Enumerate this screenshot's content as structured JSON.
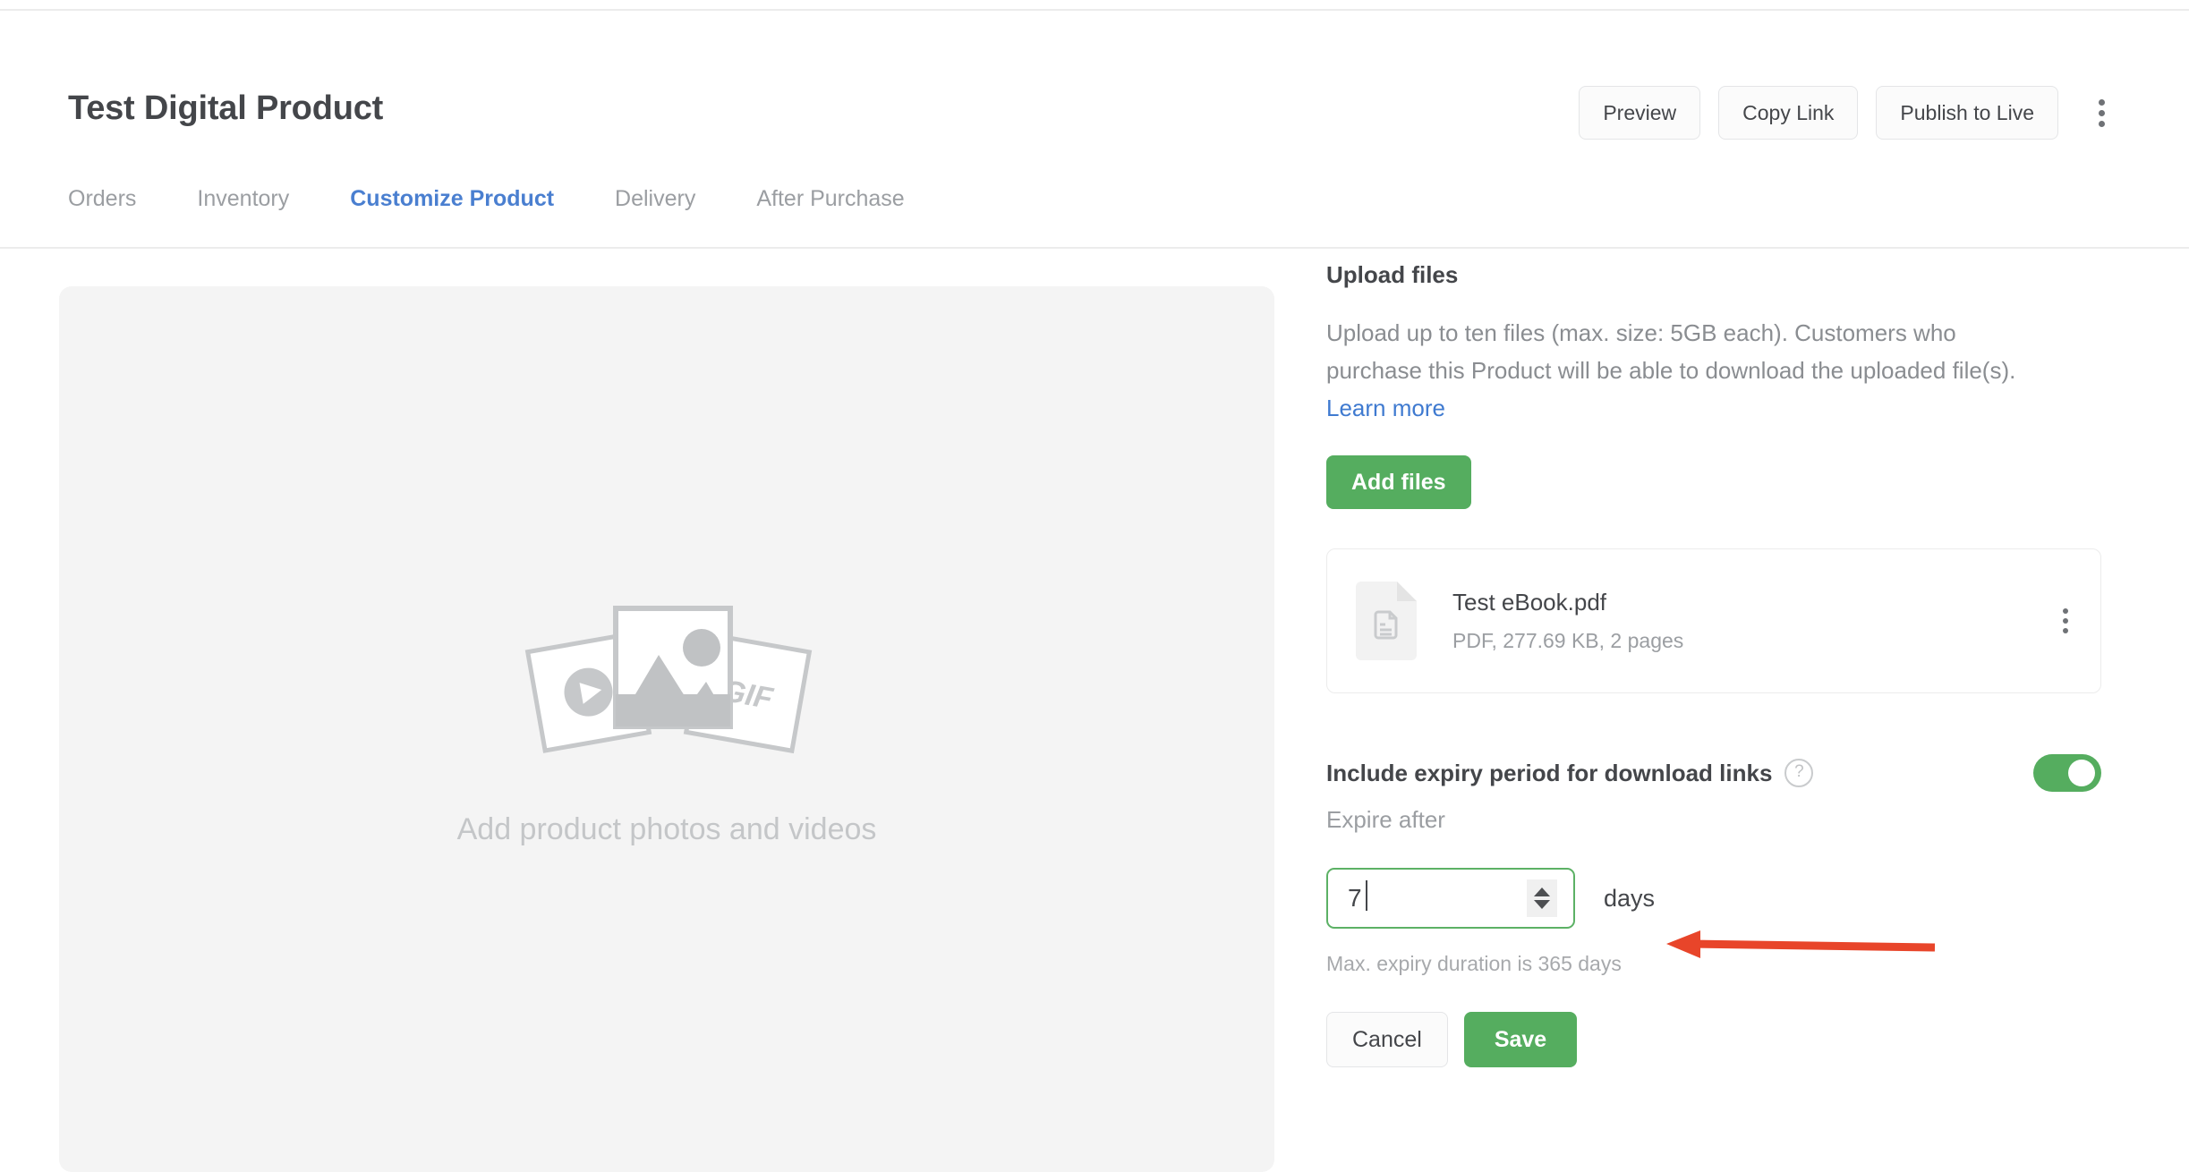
{
  "header": {
    "title": "Test Digital Product",
    "actions": [
      {
        "label": "Preview"
      },
      {
        "label": "Copy Link"
      },
      {
        "label": "Publish to Live"
      }
    ],
    "overflow_icon": "kebab-menu-icon"
  },
  "tabs": [
    {
      "label": "Orders",
      "active": false
    },
    {
      "label": "Inventory",
      "active": false
    },
    {
      "label": "Customize Product",
      "active": true
    },
    {
      "label": "Delivery",
      "active": false
    },
    {
      "label": "After Purchase",
      "active": false
    }
  ],
  "media": {
    "caption": "Add product photos and videos",
    "placeholder_badges": [
      "play-icon",
      "image-icon",
      "GIF"
    ]
  },
  "upload": {
    "title": "Upload files",
    "description": "Upload up to ten files (max. size: 5GB each). Customers who purchase this Product will be able to download the uploaded file(s).",
    "learn_more": "Learn more",
    "add_files_label": "Add files"
  },
  "file": {
    "name": "Test eBook.pdf",
    "meta": "PDF, 277.69 KB, 2 pages",
    "icon": "pdf-document-icon"
  },
  "expiry": {
    "label": "Include expiry period for download links",
    "help_icon": "question-circle-icon",
    "toggle_state": "on",
    "sub_label": "Expire after",
    "value": "7",
    "unit": "days",
    "max_note": "Max. expiry duration is 365 days"
  },
  "footer": {
    "cancel_label": "Cancel",
    "save_label": "Save"
  },
  "colors": {
    "accent_green": "#55ad5f",
    "accent_blue": "#4a7fd0",
    "annotation_red": "#e8452a"
  }
}
